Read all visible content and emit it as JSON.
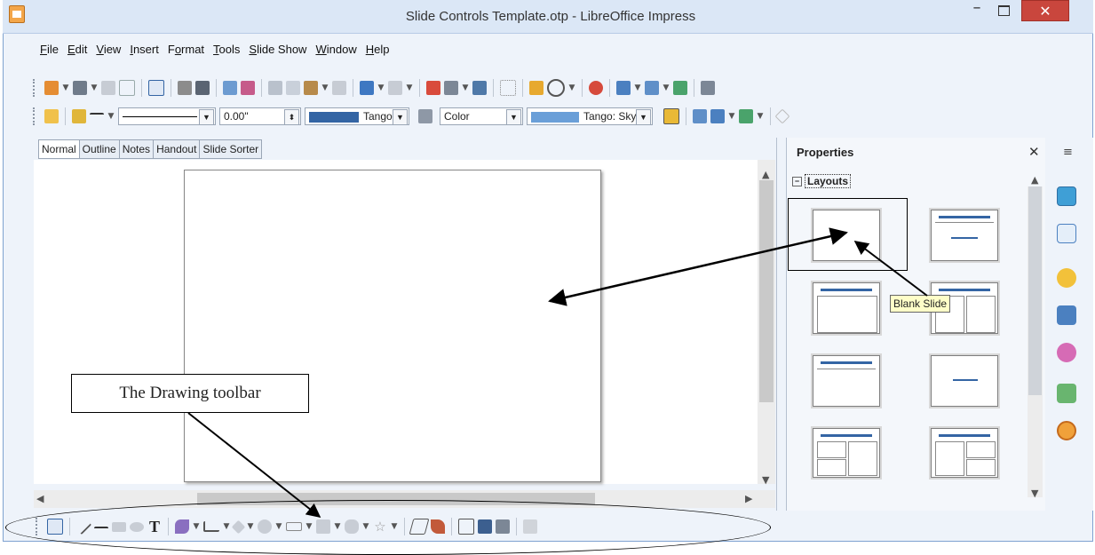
{
  "window": {
    "title": "Slide Controls Template.otp - LibreOffice Impress",
    "close_glyph": "✕",
    "min_glyph": "–"
  },
  "menu": [
    {
      "key": "F",
      "rest": "ile"
    },
    {
      "key": "E",
      "rest": "dit"
    },
    {
      "key": "V",
      "rest": "iew"
    },
    {
      "key": "I",
      "rest": "nsert"
    },
    {
      "pre": "F",
      "key": "o",
      "rest": "rmat"
    },
    {
      "key": "T",
      "rest": "ools"
    },
    {
      "key": "S",
      "rest": "lide Show"
    },
    {
      "key": "W",
      "rest": "indow"
    },
    {
      "key": "H",
      "rest": "elp"
    }
  ],
  "line_toolbar": {
    "line_width": "0.00\"",
    "fill_style": "Color",
    "line_color": "Tango",
    "fill_color": "Tango: Sky"
  },
  "view_tabs": [
    "Normal",
    "Outline",
    "Notes",
    "Handout",
    "Slide Sorter"
  ],
  "sidebar": {
    "title": "Properties",
    "section": "Layouts",
    "tooltip": "Blank Slide",
    "collapse_glyph": "⊟"
  },
  "annotation": {
    "label": "The Drawing toolbar"
  },
  "colors": {
    "accent": "#3465a4",
    "close": "#c9463d",
    "tooltip_bg": "#fefec8"
  }
}
